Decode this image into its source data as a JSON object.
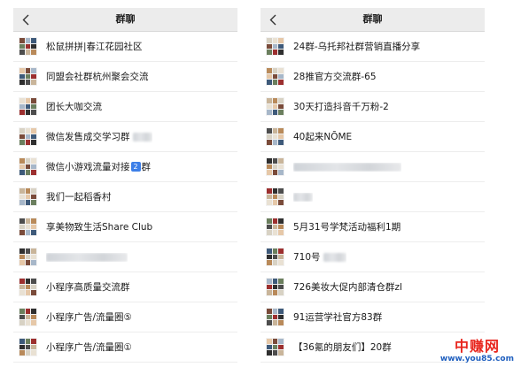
{
  "palette": [
    "#7a4b3a",
    "#c9b59a",
    "#3e5a7a",
    "#d8d2c4",
    "#9c2f2f",
    "#e6c8a8",
    "#4d4d4d",
    "#a7b7c9",
    "#b98a5a",
    "#6b7f5e",
    "#e9e1d3",
    "#2f2f2f"
  ],
  "left_panel": {
    "title": "群聊",
    "back_icon": "chevron-left-icon",
    "items": [
      {
        "pre": "松鼠拼拼|春江花园社区",
        "emoji": "",
        "post": "",
        "blur": 0
      },
      {
        "pre": "同盟会社群杭州聚会交流",
        "emoji": "",
        "post": "",
        "blur": 0
      },
      {
        "pre": "团长大咖交流",
        "emoji": "",
        "post": "",
        "blur": 0
      },
      {
        "pre": "微信发售成交学习群",
        "emoji": "",
        "post": "",
        "blur": 22
      },
      {
        "pre": "微信小游戏流量对接",
        "emoji": "2",
        "post": "群",
        "blur": 0
      },
      {
        "pre": "我们一起稻香村",
        "emoji": "",
        "post": "",
        "blur": 0
      },
      {
        "pre": "享美物致生活Share Club",
        "emoji": "",
        "post": "",
        "blur": 0
      },
      {
        "pre": "",
        "emoji": "",
        "post": "",
        "blur": 92
      },
      {
        "pre": "小程序高质量交流群",
        "emoji": "",
        "post": "",
        "blur": 0
      },
      {
        "pre": "小程序广告/流量圈⑤",
        "emoji": "",
        "post": "",
        "blur": 0
      },
      {
        "pre": "小程序广告/流量圈①",
        "emoji": "",
        "post": "",
        "blur": 0
      }
    ]
  },
  "right_panel": {
    "title": "群聊",
    "back_icon": "chevron-left-icon",
    "items": [
      {
        "pre": "24群-乌托邦社群营销直播分享",
        "emoji": "",
        "post": "",
        "blur": 0
      },
      {
        "pre": "28推官方交流群-65",
        "emoji": "",
        "post": "",
        "blur": 0
      },
      {
        "pre": "30天打造抖音千万粉-2",
        "emoji": "",
        "post": "",
        "blur": 0
      },
      {
        "pre": "40起来NŌME",
        "emoji": "",
        "post": "",
        "blur": 0
      },
      {
        "pre": "",
        "emoji": "",
        "post": "",
        "blur": 122
      },
      {
        "pre": "",
        "emoji": "",
        "post": "",
        "blur": 22
      },
      {
        "pre": "5月31号学梵活动福利1期",
        "emoji": "",
        "post": "",
        "blur": 0
      },
      {
        "pre": "710号",
        "emoji": "",
        "post": "",
        "blur": 26
      },
      {
        "pre": "726美妆大促内部清仓群zl",
        "emoji": "",
        "post": "",
        "blur": 0
      },
      {
        "pre": "91运营学社官方83群",
        "emoji": "",
        "post": "",
        "blur": 0
      },
      {
        "pre": "【36氪的朋友们】20群",
        "emoji": "",
        "post": "",
        "blur": 0
      }
    ]
  },
  "watermark": {
    "cn": "中赚网",
    "url": "www.you85.com"
  }
}
